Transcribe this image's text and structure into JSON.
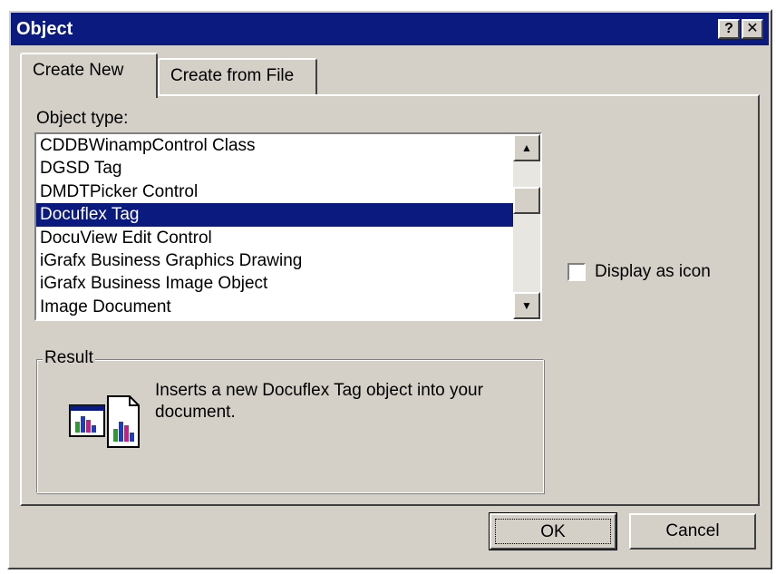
{
  "window": {
    "title": "Object",
    "help_glyph": "?",
    "close_glyph": "✕"
  },
  "tabs": [
    {
      "label": "Create New",
      "active": true
    },
    {
      "label": "Create from File",
      "active": false
    }
  ],
  "object_type": {
    "label": "Object type:",
    "items": [
      "CDDBWinampControl Class",
      "DGSD Tag",
      "DMDTPicker Control",
      "Docuflex Tag",
      "DocuView Edit Control",
      "iGrafx Business Graphics Drawing",
      "iGrafx Business Image Object",
      "Image Document"
    ],
    "selected": "Docuflex Tag"
  },
  "display_as_icon": {
    "label": "Display as icon",
    "checked": false
  },
  "result": {
    "label": "Result",
    "description": "Inserts a new Docuflex Tag object into your document.",
    "icon": "insert-object-icon"
  },
  "buttons": {
    "ok": "OK",
    "cancel": "Cancel"
  },
  "colors": {
    "title_bar": "#0a1a7e",
    "selection": "#0a1a7e",
    "dialog_face": "#d4d0c8"
  }
}
